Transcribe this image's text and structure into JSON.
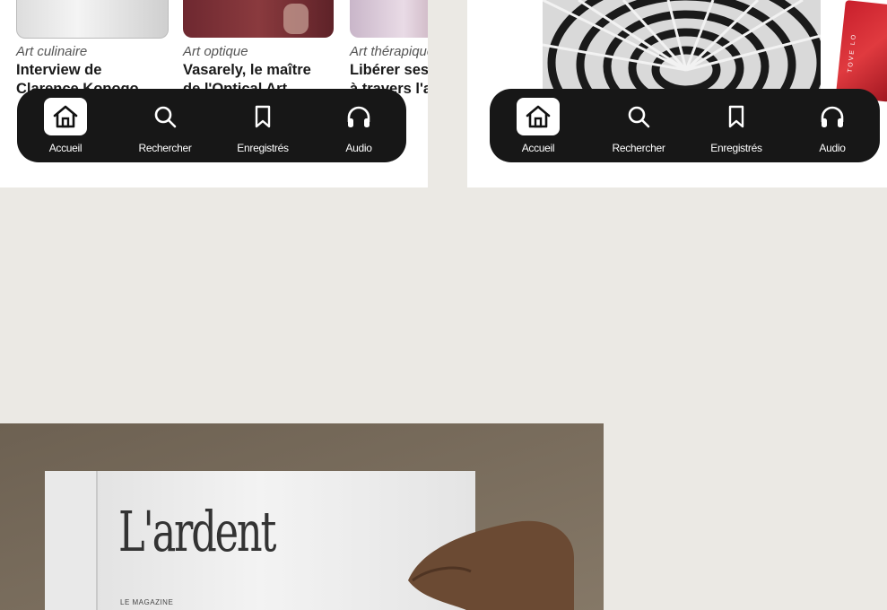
{
  "left_screen": {
    "cards": [
      {
        "category": "Art culinaire",
        "title_line1": "Interview de",
        "title_line2": "Clarence Kopogo"
      },
      {
        "category": "Art optique",
        "title_line1": "Vasarely, le maître",
        "title_line2": "de l'Optical Art"
      },
      {
        "category": "Art thérapique",
        "title_line1": "Libérer ses é",
        "title_line2": "à travers l'ar"
      }
    ]
  },
  "nav": {
    "items": [
      {
        "label": "Accueil",
        "icon": "home-icon",
        "active": true
      },
      {
        "label": "Rechercher",
        "icon": "search-icon",
        "active": false
      },
      {
        "label": "Enregistrés",
        "icon": "bookmark-icon",
        "active": false
      },
      {
        "label": "Audio",
        "icon": "headphones-icon",
        "active": false
      }
    ]
  },
  "right_screen": {
    "album_side_text": "TOVE LO"
  },
  "photo": {
    "magazine_title": "L'ardent",
    "magazine_subtitle": "LE MAGAZINE"
  },
  "colors": {
    "background": "#ebe9e4",
    "navbar": "#171717",
    "nav_active_bg": "#ffffff",
    "card_image_red": "#7a2a30"
  }
}
